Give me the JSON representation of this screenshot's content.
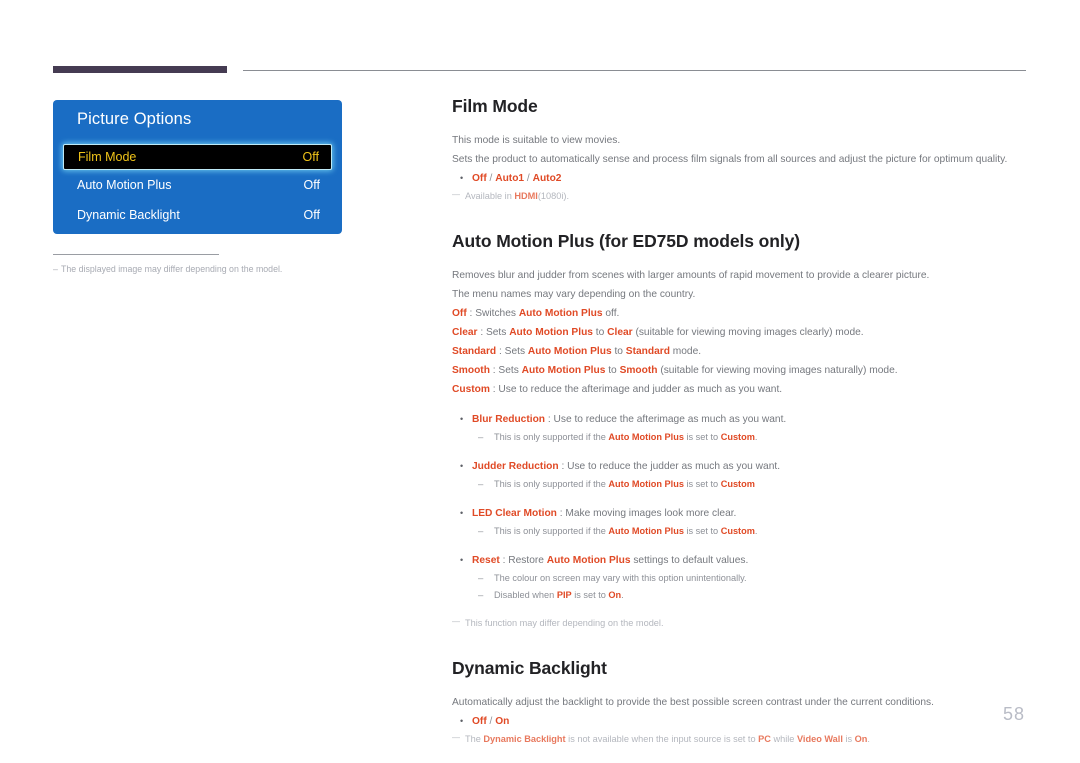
{
  "page": {
    "number": "58",
    "accent_color": "#e04a26",
    "panel_color": "#1a6dc4",
    "rule_color": "#453b52"
  },
  "osd": {
    "title": "Picture Options",
    "rows": [
      {
        "label": "Film Mode",
        "value": "Off",
        "selected": true
      },
      {
        "label": "Auto Motion Plus",
        "value": "Off",
        "selected": false
      },
      {
        "label": "Dynamic Backlight",
        "value": "Off",
        "selected": false
      }
    ],
    "caption": "The displayed image may differ depending on the model."
  },
  "sections": [
    {
      "id": "film-mode",
      "title": "Film Mode",
      "line1": "This mode is suitable to view movies.",
      "line2": "Sets the product to automatically sense and process film signals from all sources and adjust the picture for optimum quality.",
      "options": {
        "a": "Off",
        "b": "Auto1",
        "c": "Auto2",
        "sep": " / "
      },
      "note": {
        "pre": "Available in ",
        "term": "HDMI",
        "post": "(1080i)."
      }
    },
    {
      "id": "auto-motion-plus",
      "title": "Auto Motion Plus (for ED75D models only)",
      "line1": "Removes blur and judder from scenes with larger amounts of rapid movement to provide a clearer picture.",
      "line2": "The menu names may vary depending on the country.",
      "defs": [
        {
          "term": "Off",
          "pre": " : Switches ",
          "ref": "Auto Motion Plus",
          "post": " off."
        },
        {
          "term": "Clear",
          "pre": " : Sets ",
          "ref": "Auto Motion Plus",
          "mid": " to ",
          "value": "Clear",
          "post": " (suitable for viewing moving images clearly) mode."
        },
        {
          "term": "Standard",
          "pre": " : Sets ",
          "ref": "Auto Motion Plus",
          "mid": " to ",
          "value": "Standard",
          "post": " mode."
        },
        {
          "term": "Smooth",
          "pre": " : Sets ",
          "ref": "Auto Motion Plus",
          "mid": " to ",
          "value": "Smooth",
          "post": " (suitable for viewing moving images naturally) mode."
        },
        {
          "term": "Custom",
          "pre": " : Use to reduce the afterimage and judder as much as you want.",
          "ref": "",
          "post": ""
        }
      ],
      "bullets": [
        {
          "term": "Blur Reduction",
          "text": " : Use to reduce the afterimage as much as you want.",
          "subs": [
            {
              "pre": "This is only supported if the ",
              "ref": "Auto Motion Plus",
              "mid": " is set to ",
              "value": "Custom",
              "post": "."
            }
          ]
        },
        {
          "term": "Judder Reduction",
          "text": " : Use to reduce the judder as much as you want.",
          "subs": [
            {
              "pre": "This is only supported if the ",
              "ref": "Auto Motion Plus",
              "mid": " is set to ",
              "value": "Custom",
              "post": ""
            }
          ]
        },
        {
          "term": "LED Clear Motion",
          "text": " :  Make moving images look more clear.",
          "subs": [
            {
              "pre": "This is only supported if the ",
              "ref": "Auto Motion Plus",
              "mid": " is set to ",
              "value": "Custom",
              "post": "."
            }
          ]
        },
        {
          "term": "Reset",
          "text": " : Restore ",
          "ref": "Auto Motion Plus",
          "tail": " settings to default values.",
          "subs": [
            {
              "pre": "The colour on screen may vary with this option unintentionally.",
              "ref": "",
              "mid": "",
              "value": "",
              "post": ""
            },
            {
              "pre": "Disabled when ",
              "ref": "PIP",
              "mid": " is set to ",
              "value": "On",
              "post": "."
            }
          ]
        }
      ],
      "note": "This function may differ depending on the model."
    },
    {
      "id": "dynamic-backlight",
      "title": "Dynamic Backlight",
      "line1": "Automatically adjust the backlight to provide the best possible screen contrast under the current conditions.",
      "options": {
        "a": "Off",
        "b": "On",
        "sep": " / "
      },
      "note": {
        "pre": "The ",
        "term": "Dynamic Backlight",
        "mid": " is not available when the input source is set to ",
        "term2": "PC",
        "mid2": " while ",
        "term3": "Video Wall",
        "mid3": " is ",
        "term4": "On",
        "post": "."
      }
    }
  ]
}
